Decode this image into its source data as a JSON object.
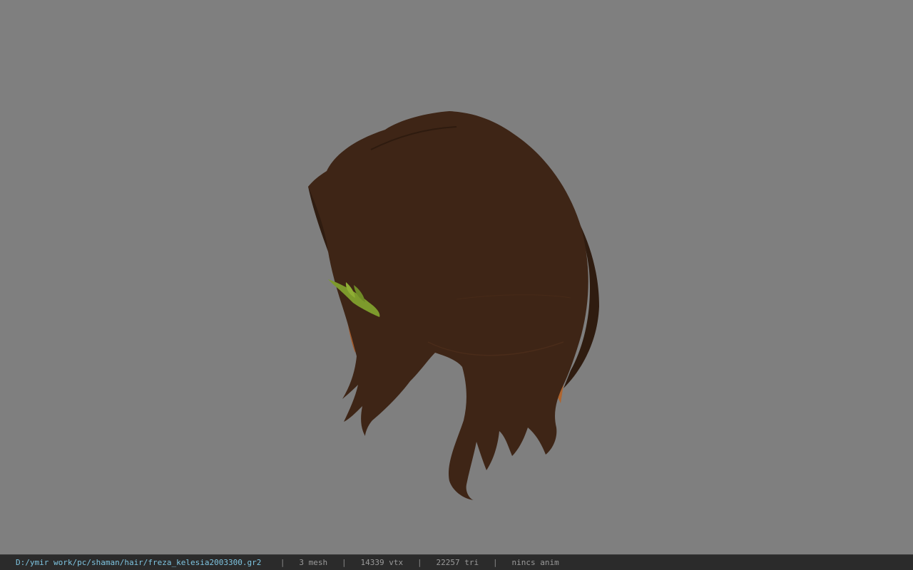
{
  "viewport": {
    "background": "#7f7f7f",
    "model": "hair-mesh",
    "colors": {
      "hair": "#3e2516",
      "hair_highlight": "#a55a2a",
      "hair_rim": "#2f1c10",
      "ornament": "#7d9a2c"
    }
  },
  "status_bar": {
    "file_path": "D:/ymir work/pc/shaman/hair/freza_kelesia2003300.gr2",
    "separator": "|",
    "mesh_count": "3 mesh",
    "vertex_count": "14339 vtx",
    "triangle_count": "22257 tri",
    "anim_status": "nincs anim",
    "path_color": "#7ec4e0"
  }
}
